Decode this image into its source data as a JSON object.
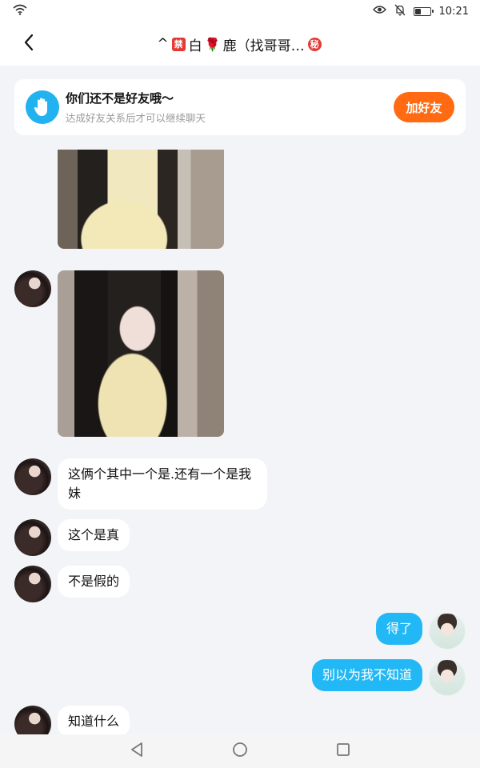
{
  "status": {
    "time": "10:21",
    "battery_level": 0.35
  },
  "header": {
    "prefix": "^",
    "badge_ban": "禁",
    "name_part1": "白",
    "rose": "🌹",
    "name_part2": "鹿（找哥哥…",
    "badge_secret": "秘"
  },
  "friend_card": {
    "title": "你们还不是好友哦～",
    "subtitle": "达成好友关系后才可以继续聊天",
    "button": "加好友"
  },
  "messages": [
    {
      "side": "in",
      "type": "image"
    },
    {
      "side": "in",
      "type": "image"
    },
    {
      "side": "in",
      "type": "text",
      "text": "这俩个其中一个是.还有一个是我妹"
    },
    {
      "side": "in",
      "type": "text",
      "text": "这个是真"
    },
    {
      "side": "in",
      "type": "text",
      "text": "不是假的"
    },
    {
      "side": "out",
      "type": "text",
      "text": "得了"
    },
    {
      "side": "out",
      "type": "text",
      "text": "别以为我不知道"
    },
    {
      "side": "in",
      "type": "text",
      "text": "知道什么"
    }
  ],
  "colors": {
    "accent_blue": "#22b8f5",
    "add_button": "#ff6a13",
    "background": "#f3f4f8"
  },
  "icons": {
    "back": "chevron-left-icon",
    "hand": "hand-wave-icon",
    "wifi": "wifi-icon",
    "eye": "eye-icon",
    "mute": "bell-off-icon",
    "battery": "battery-icon",
    "nav_back": "triangle-back-icon",
    "nav_home": "circle-home-icon",
    "nav_recent": "square-recent-icon"
  }
}
